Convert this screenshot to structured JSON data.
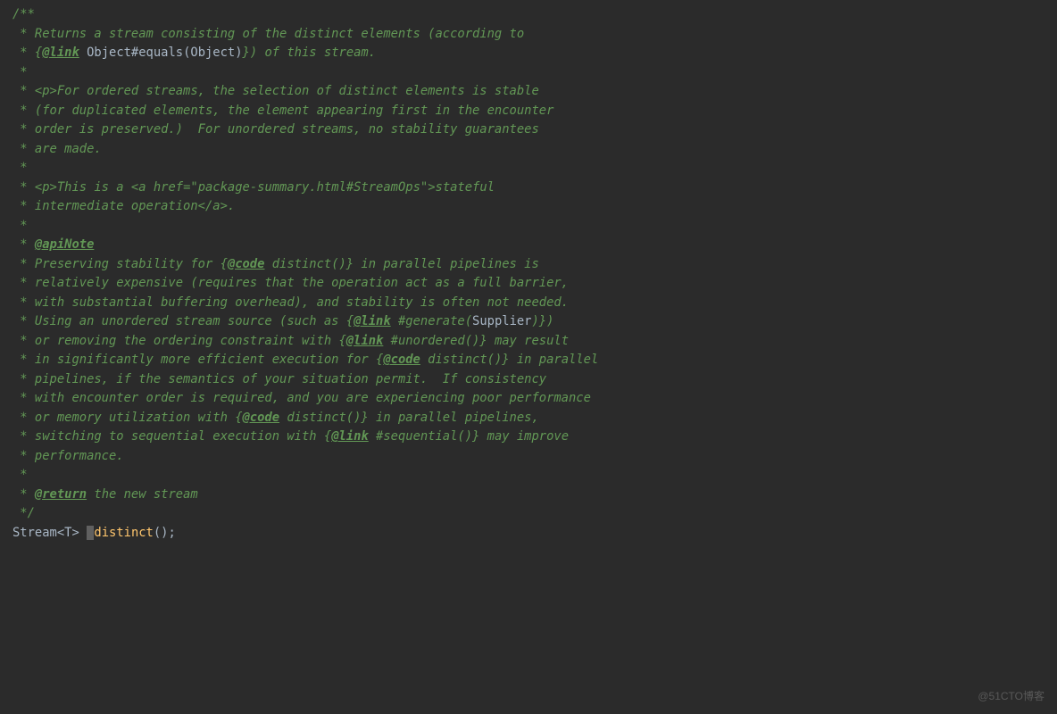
{
  "code": {
    "l01a": "/**",
    "l02a": " * Returns a stream consisting of the distinct elements (according to",
    "l03a": " * {",
    "l03b": "@link",
    "l03c": " ",
    "l03d": "Object#equals(Object)",
    "l03e": "}) of this stream.",
    "l04a": " *",
    "l05a": " * ",
    "l05b": "<p>",
    "l05c": "For ordered streams, the selection of distinct elements is stable",
    "l06a": " * (for duplicated elements, the element appearing first in the encounter",
    "l07a": " * order is preserved.)  For unordered streams, no stability guarantees",
    "l08a": " * are made.",
    "l09a": " *",
    "l10a": " * ",
    "l10b": "<p>",
    "l10c": "This is a ",
    "l10d": "<a href=\"",
    "l10e": "package-summary.html#StreamOps",
    "l10f": "\">",
    "l10g": "stateful",
    "l11a": " * intermediate operation",
    "l11b": "</a>",
    "l11c": ".",
    "l12a": " *",
    "l13a": " * ",
    "l13b": "@apiNote",
    "l14a": " * Preserving stability for {",
    "l14b": "@code",
    "l14c": " distinct()} in parallel pipelines is",
    "l15a": " * relatively expensive (requires that the operation act as a full barrier,",
    "l16a": " * with substantial buffering overhead), and stability is often not needed.",
    "l17a": " * Using an unordered stream source (such as {",
    "l17b": "@link",
    "l17c": " #generate(",
    "l17d": "Supplier",
    "l17e": ")})",
    "l18a": " * or removing the ordering constraint with {",
    "l18b": "@link",
    "l18c": " #unordered()} may result",
    "l19a": " * in significantly more efficient execution for {",
    "l19b": "@code",
    "l19c": " distinct()} in parallel",
    "l20a": " * pipelines, if the semantics of your situation permit.  If consistency",
    "l21a": " * with encounter order is required, and you are experiencing poor performance",
    "l22a": " * or memory utilization with {",
    "l22b": "@code",
    "l22c": " distinct()} in parallel pipelines,",
    "l23a": " * switching to sequential execution with {",
    "l23b": "@link",
    "l23c": " #sequential()} may improve",
    "l24a": " * performance.",
    "l25a": " *",
    "l26a": " * ",
    "l26b": "@return",
    "l26c": " the new stream",
    "l27a": " */",
    "decl_type": "Stream",
    "decl_generic_open": "<",
    "decl_generic_t": "T",
    "decl_generic_close": "> ",
    "decl_method": "distinct",
    "decl_tail": "();"
  },
  "watermark": "@51CTO博客"
}
